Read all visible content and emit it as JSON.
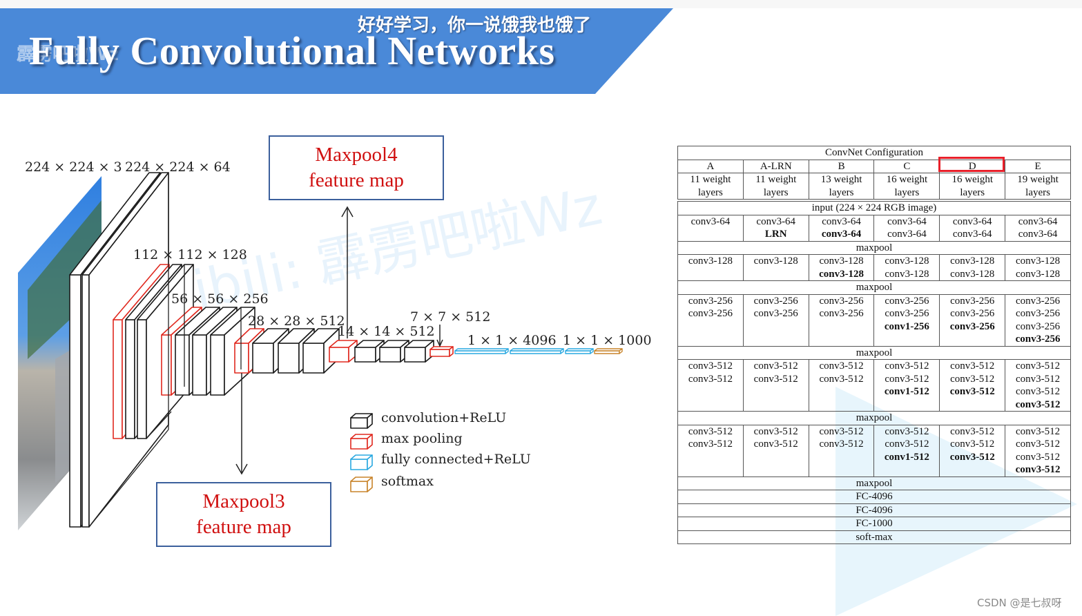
{
  "slide": {
    "title": "Fully Convolutional Networks",
    "subtitle_overlay": "好好学习，你一说饿我也饿了",
    "watermark_top": "霹雳吧啦Wz",
    "watermark_diagonal": "bilibili: 霹雳吧啦Wz",
    "footer_credit": "CSDN @是七叔呀",
    "colors": {
      "banner": "#4a89d8",
      "conv": "#1a1a1a",
      "maxpool": "#e0281e",
      "fc": "#29a8e0",
      "softmax": "#c8842a",
      "highlight": "#e8202a",
      "feature_box_border": "#3b5f9c",
      "feature_box_text": "#d01010"
    }
  },
  "diagram": {
    "dimension_labels": [
      "224 × 224 × 3",
      "224 × 224 × 64",
      "112 × 112 × 128",
      "56 × 56 × 256",
      "28 × 28 × 512",
      "14 × 14 × 512",
      "7 × 7 × 512",
      "1 × 1 × 4096",
      "1 × 1 × 1000"
    ],
    "callouts": {
      "maxpool4": {
        "line1": "Maxpool4",
        "line2": "feature map"
      },
      "maxpool3": {
        "line1": "Maxpool3",
        "line2": "feature map"
      }
    },
    "legend": [
      {
        "type": "conv",
        "label": "convolution+ReLU"
      },
      {
        "type": "maxpool",
        "label": "max pooling"
      },
      {
        "type": "fc",
        "label": "fully connected+ReLU"
      },
      {
        "type": "softmax",
        "label": "softmax"
      }
    ]
  },
  "table": {
    "title": "ConvNet Configuration",
    "columns": [
      {
        "name": "A",
        "depth_line1": "11 weight",
        "depth_line2": "layers"
      },
      {
        "name": "A-LRN",
        "depth_line1": "11 weight",
        "depth_line2": "layers"
      },
      {
        "name": "B",
        "depth_line1": "13 weight",
        "depth_line2": "layers"
      },
      {
        "name": "C",
        "depth_line1": "16 weight",
        "depth_line2": "layers"
      },
      {
        "name": "D",
        "depth_line1": "16 weight",
        "depth_line2": "layers",
        "highlighted": true
      },
      {
        "name": "E",
        "depth_line1": "19 weight",
        "depth_line2": "layers"
      }
    ],
    "input_row": "input (224 × 224 RGB image)",
    "blocks": [
      {
        "cells": [
          [
            {
              "t": "conv3-64"
            }
          ],
          [
            {
              "t": "conv3-64"
            },
            {
              "t": "LRN",
              "b": true
            }
          ],
          [
            {
              "t": "conv3-64"
            },
            {
              "t": "conv3-64",
              "b": true
            }
          ],
          [
            {
              "t": "conv3-64"
            },
            {
              "t": "conv3-64"
            }
          ],
          [
            {
              "t": "conv3-64"
            },
            {
              "t": "conv3-64"
            }
          ],
          [
            {
              "t": "conv3-64"
            },
            {
              "t": "conv3-64"
            }
          ]
        ],
        "after": "maxpool"
      },
      {
        "cells": [
          [
            {
              "t": "conv3-128"
            }
          ],
          [
            {
              "t": "conv3-128"
            }
          ],
          [
            {
              "t": "conv3-128"
            },
            {
              "t": "conv3-128",
              "b": true
            }
          ],
          [
            {
              "t": "conv3-128"
            },
            {
              "t": "conv3-128"
            }
          ],
          [
            {
              "t": "conv3-128"
            },
            {
              "t": "conv3-128"
            }
          ],
          [
            {
              "t": "conv3-128"
            },
            {
              "t": "conv3-128"
            }
          ]
        ],
        "after": "maxpool"
      },
      {
        "cells": [
          [
            {
              "t": "conv3-256"
            },
            {
              "t": "conv3-256"
            }
          ],
          [
            {
              "t": "conv3-256"
            },
            {
              "t": "conv3-256"
            }
          ],
          [
            {
              "t": "conv3-256"
            },
            {
              "t": "conv3-256"
            }
          ],
          [
            {
              "t": "conv3-256"
            },
            {
              "t": "conv3-256"
            },
            {
              "t": "conv1-256",
              "b": true
            }
          ],
          [
            {
              "t": "conv3-256"
            },
            {
              "t": "conv3-256"
            },
            {
              "t": "conv3-256",
              "b": true
            }
          ],
          [
            {
              "t": "conv3-256"
            },
            {
              "t": "conv3-256"
            },
            {
              "t": "conv3-256"
            },
            {
              "t": "conv3-256",
              "b": true
            }
          ]
        ],
        "after": "maxpool"
      },
      {
        "cells": [
          [
            {
              "t": "conv3-512"
            },
            {
              "t": "conv3-512"
            }
          ],
          [
            {
              "t": "conv3-512"
            },
            {
              "t": "conv3-512"
            }
          ],
          [
            {
              "t": "conv3-512"
            },
            {
              "t": "conv3-512"
            }
          ],
          [
            {
              "t": "conv3-512"
            },
            {
              "t": "conv3-512"
            },
            {
              "t": "conv1-512",
              "b": true
            }
          ],
          [
            {
              "t": "conv3-512"
            },
            {
              "t": "conv3-512"
            },
            {
              "t": "conv3-512",
              "b": true
            }
          ],
          [
            {
              "t": "conv3-512"
            },
            {
              "t": "conv3-512"
            },
            {
              "t": "conv3-512"
            },
            {
              "t": "conv3-512",
              "b": true
            }
          ]
        ],
        "after": "maxpool"
      },
      {
        "cells": [
          [
            {
              "t": "conv3-512"
            },
            {
              "t": "conv3-512"
            }
          ],
          [
            {
              "t": "conv3-512"
            },
            {
              "t": "conv3-512"
            }
          ],
          [
            {
              "t": "conv3-512"
            },
            {
              "t": "conv3-512"
            }
          ],
          [
            {
              "t": "conv3-512"
            },
            {
              "t": "conv3-512"
            },
            {
              "t": "conv1-512",
              "b": true
            }
          ],
          [
            {
              "t": "conv3-512"
            },
            {
              "t": "conv3-512"
            },
            {
              "t": "conv3-512",
              "b": true
            }
          ],
          [
            {
              "t": "conv3-512"
            },
            {
              "t": "conv3-512"
            },
            {
              "t": "conv3-512"
            },
            {
              "t": "conv3-512",
              "b": true
            }
          ]
        ],
        "after": "maxpool"
      }
    ],
    "tail_rows": [
      "FC-4096",
      "FC-4096",
      "FC-1000",
      "soft-max"
    ]
  }
}
